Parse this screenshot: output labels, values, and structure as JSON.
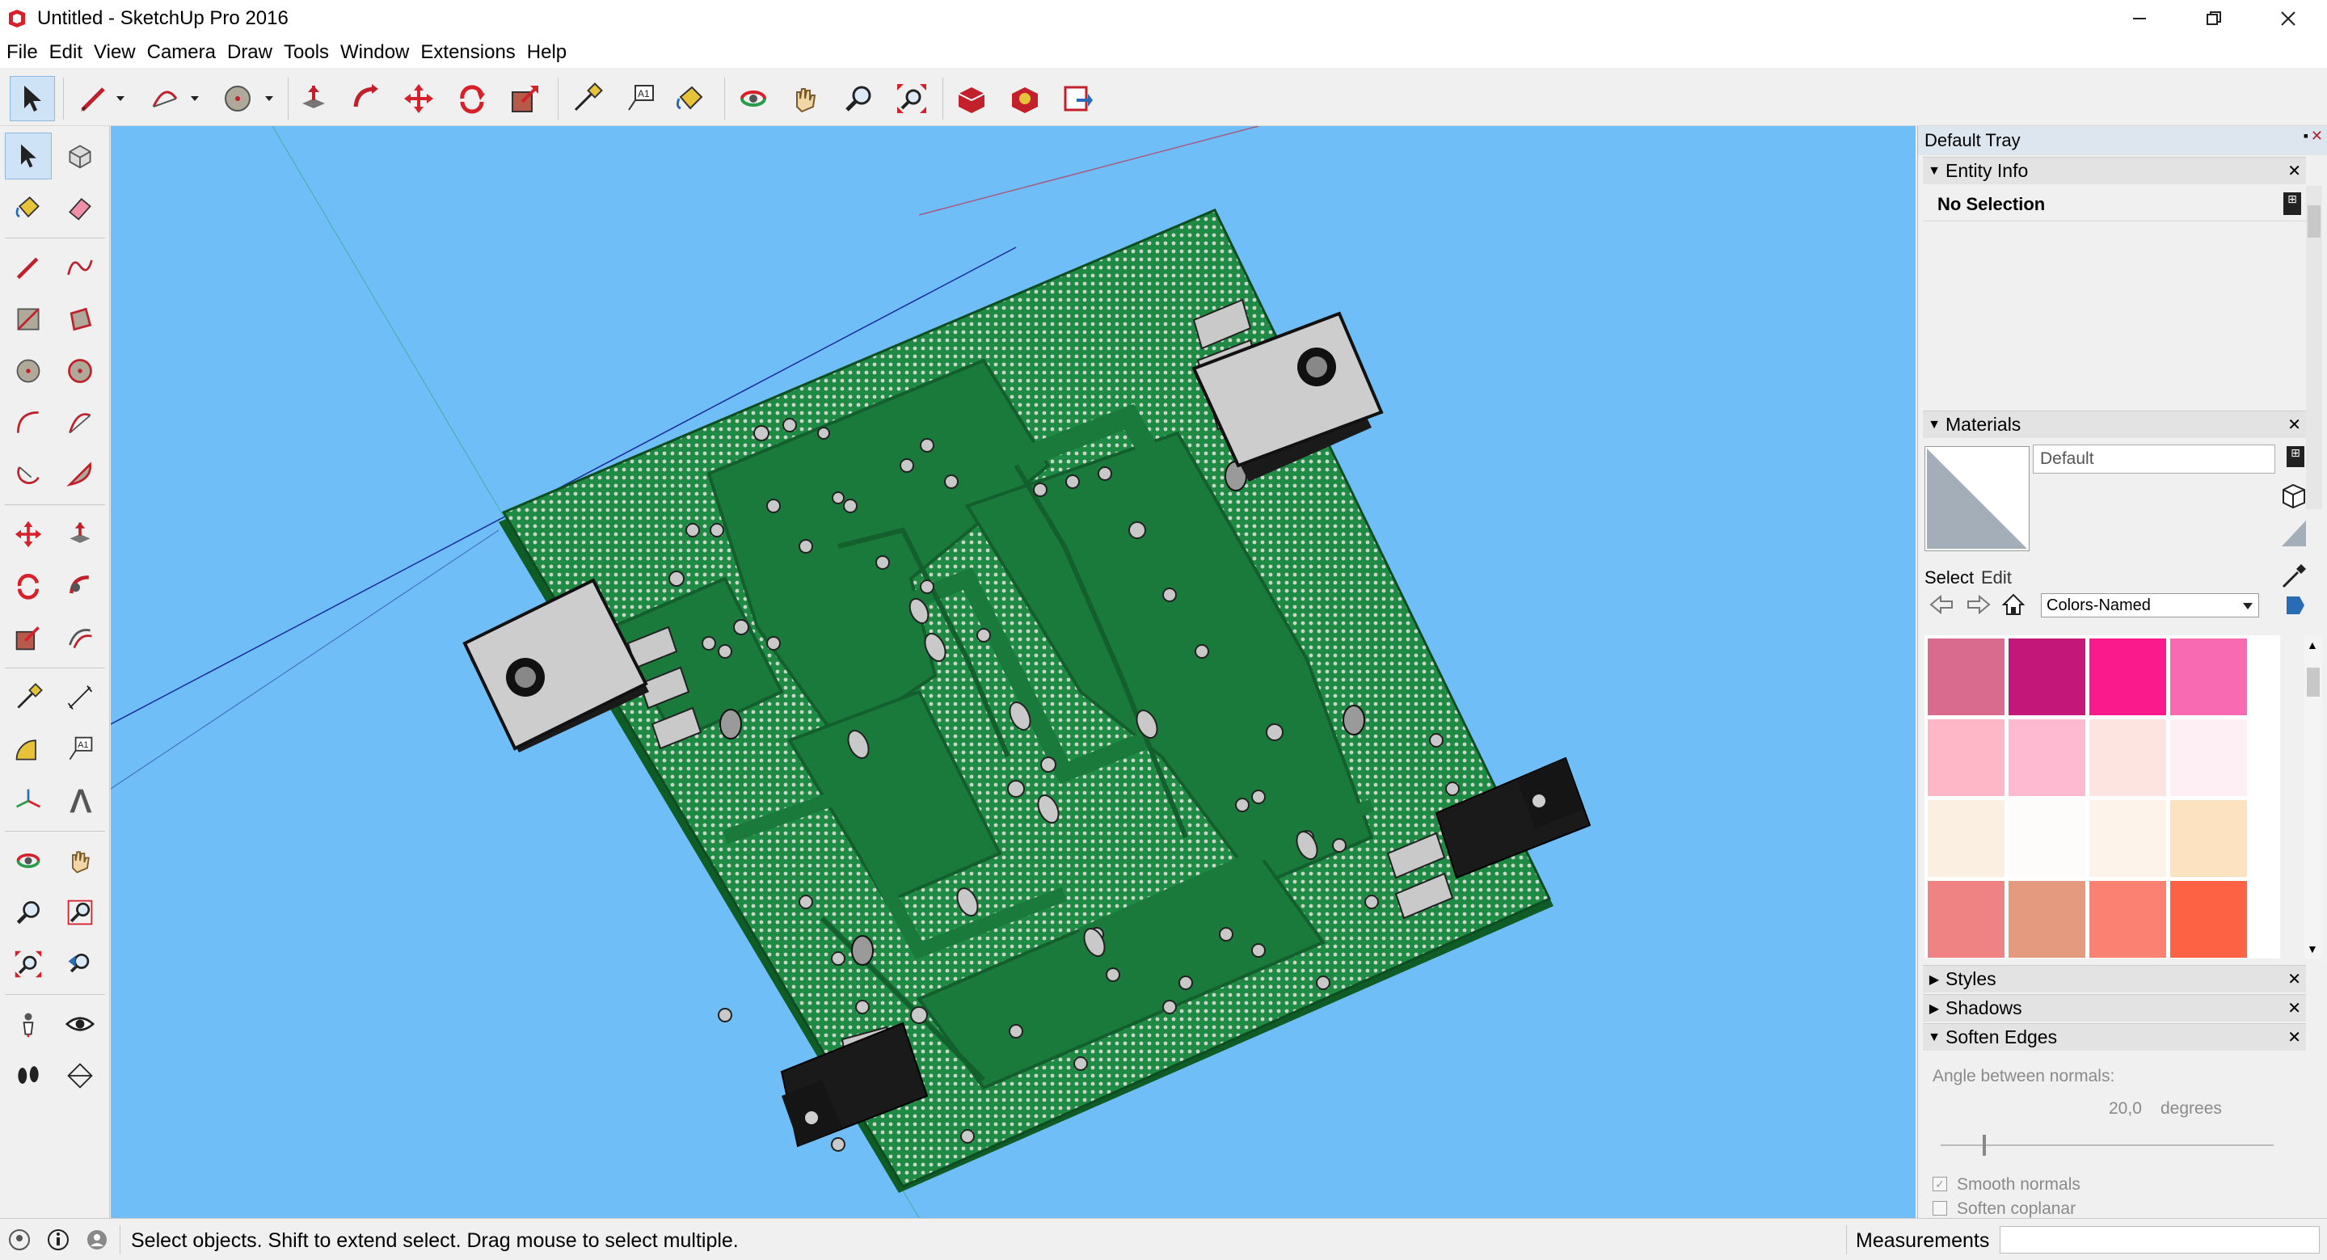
{
  "window": {
    "title": "Untitled - SketchUp Pro 2016"
  },
  "menu": [
    "File",
    "Edit",
    "View",
    "Camera",
    "Draw",
    "Tools",
    "Window",
    "Extensions",
    "Help"
  ],
  "tray": {
    "title": "Default Tray",
    "entity_info": {
      "header": "Entity Info",
      "selection": "No Selection"
    },
    "materials": {
      "header": "Materials",
      "material_name": "Default",
      "tab_select": "Select",
      "tab_edit": "Edit",
      "library": "Colors-Named",
      "swatches": [
        "#d96b8f",
        "#c4177a",
        "#fb1a8b",
        "#f86ab2",
        "#feb7c6",
        "#fdbad0",
        "#fde4e0",
        "#fdeff4",
        "#fbefe2",
        "#fefcfb",
        "#fef3ea",
        "#fde2c2",
        "#ef8282",
        "#e49a7e",
        "#fb8272",
        "#fd6244"
      ]
    },
    "styles": {
      "header": "Styles"
    },
    "shadows": {
      "header": "Shadows"
    },
    "soften_edges": {
      "header": "Soften Edges",
      "angle_label": "Angle between normals:",
      "angle_value": "20,0",
      "angle_unit": "degrees",
      "smooth_normals": "Smooth normals",
      "soften_coplanar": "Soften coplanar"
    }
  },
  "status": {
    "message": "Select objects. Shift to extend select. Drag mouse to select multiple.",
    "measurements_label": "Measurements"
  },
  "colors": {
    "viewport_bg": "#6fbef7",
    "pcb_green": "#1e7f3e",
    "pcb_dark": "#0f6a2e",
    "heatsink": "#cfcfcf"
  }
}
